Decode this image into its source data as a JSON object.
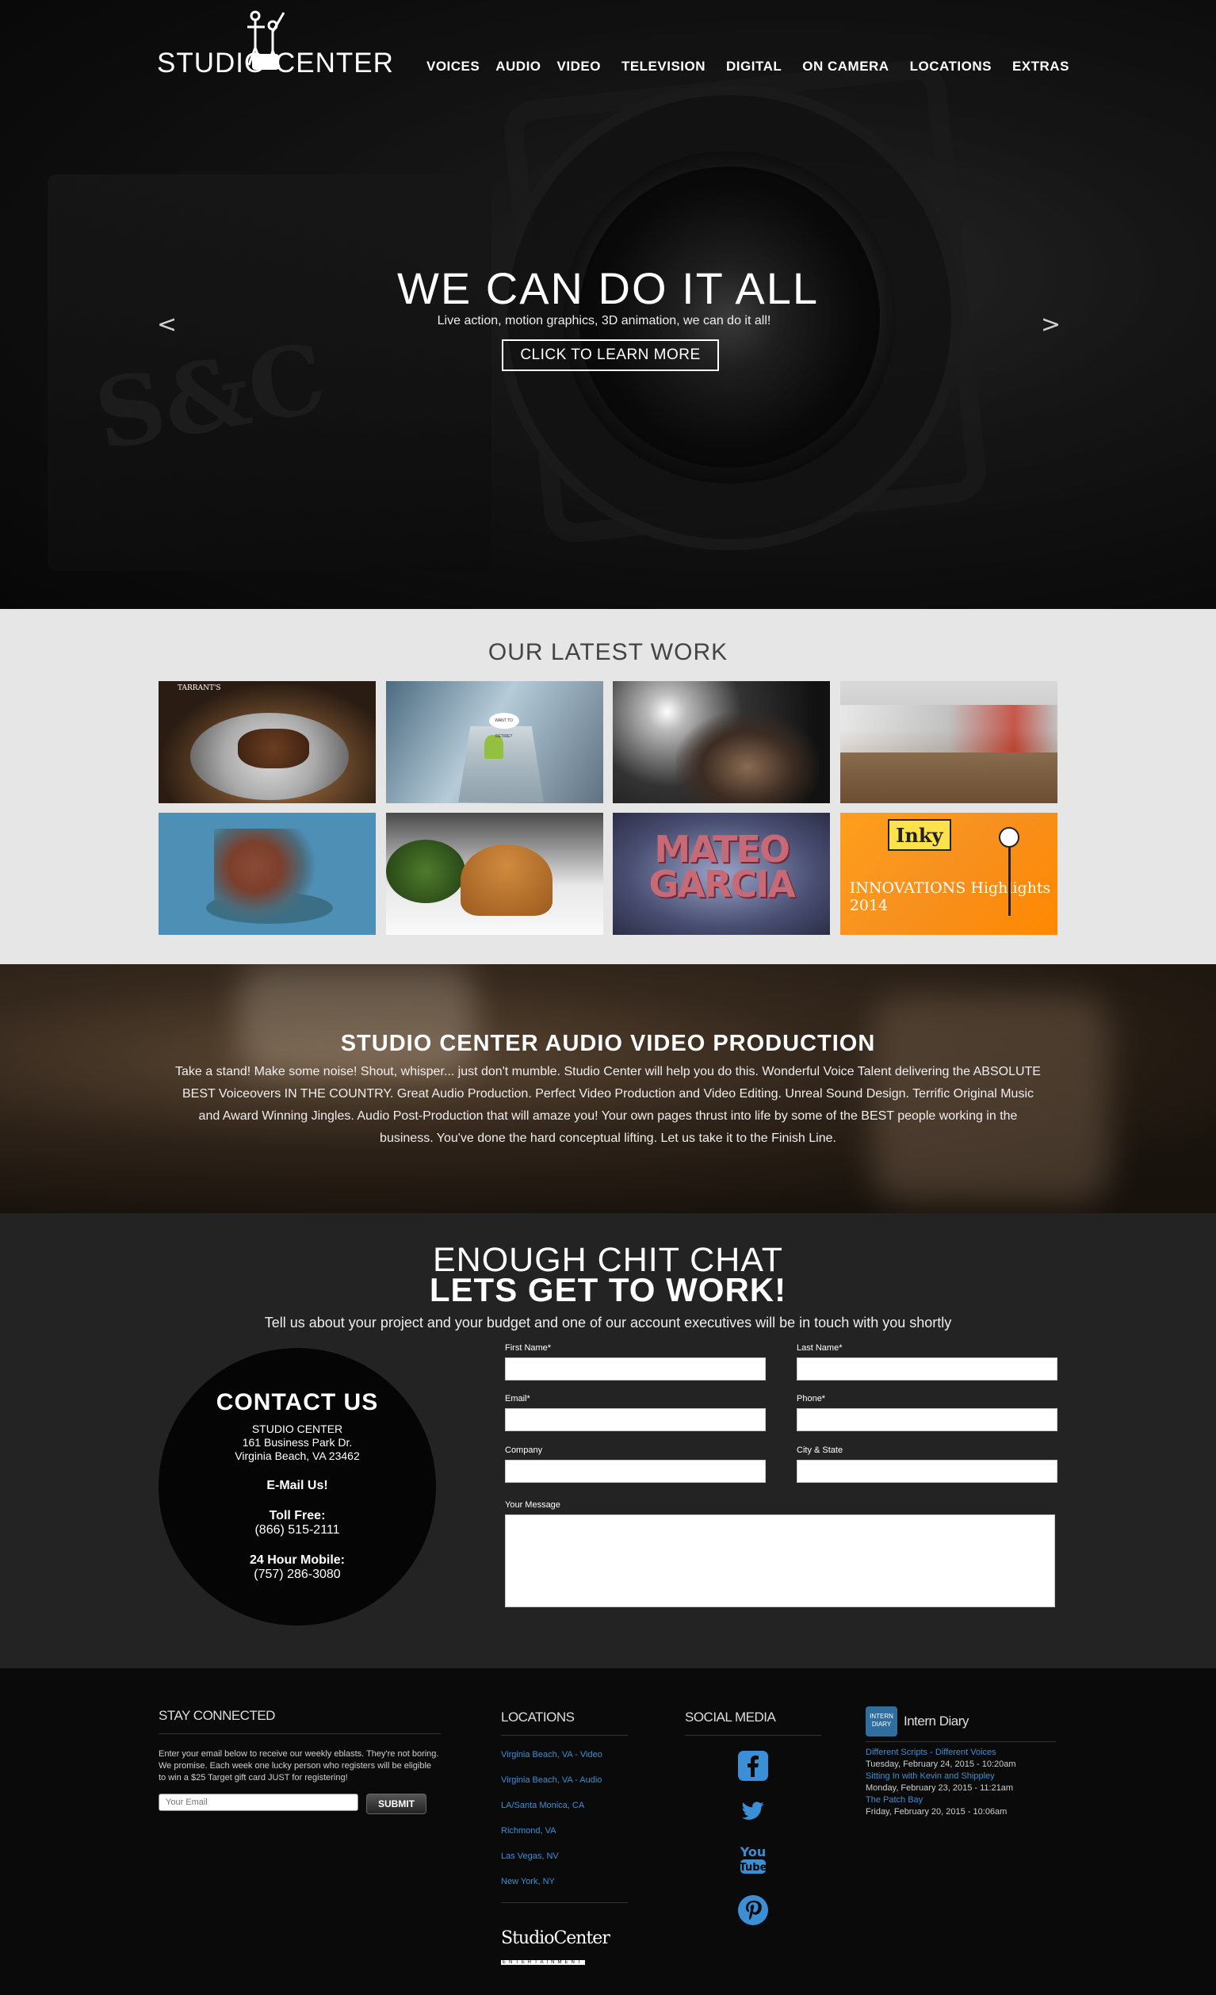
{
  "brand": {
    "name": "STUDIO CENTER"
  },
  "nav": [
    "VOICES",
    "AUDIO",
    "VIDEO",
    "TELEVISION",
    "DIGITAL",
    "ON CAMERA",
    "LOCATIONS",
    "EXTRAS"
  ],
  "hero": {
    "title": "WE CAN DO IT ALL",
    "subtitle": "Live action, motion graphics, 3D animation, we can do it all!",
    "cta": "CLICK TO LEARN MORE",
    "prev": "<",
    "next": ">"
  },
  "work": {
    "heading": "OUR LATEST WORK",
    "thumb_labels": {
      "t1": "TARRANT'S",
      "t2": "WANT TO RETIRE?",
      "t7": "MATEO GARCIA",
      "t8_inky": "Inky",
      "t8_sub": "INNOVATIONS Highlights 2014"
    }
  },
  "production": {
    "heading": "STUDIO CENTER AUDIO VIDEO PRODUCTION",
    "body": "Take a stand! Make some noise! Shout, whisper... just don't mumble. Studio Center will help you do this. Wonderful Voice Talent delivering the ABSOLUTE BEST Voiceovers IN THE COUNTRY. Great Audio Production. Perfect Video Production and Video Editing. Unreal Sound Design. Terrific Original Music and Award Winning Jingles. Audio Post-Production that will amaze you! Your own pages thrust into life by some of the BEST people working in the business. You've done the hard conceptual lifting. Let us take it to the Finish Line."
  },
  "contact": {
    "heading1": "ENOUGH CHIT CHAT",
    "heading2": "LETS GET TO WORK!",
    "intro": "Tell us about your project and your budget and one of our account executives will be in touch with you shortly",
    "circle": {
      "title": "CONTACT US",
      "company": "STUDIO CENTER",
      "address1": "161 Business Park Dr.",
      "address2": "Virginia Beach, VA 23462",
      "email": "E-Mail Us!",
      "tollfree_label": "Toll Free:",
      "tollfree": "(866) 515-2111",
      "mobile_label": "24 Hour Mobile:",
      "mobile": "(757) 286-3080"
    },
    "form": {
      "first_name": "First Name*",
      "last_name": "Last Name*",
      "email": "Email*",
      "phone": "Phone*",
      "company": "Company",
      "city_state": "City & State",
      "message": "Your Message"
    }
  },
  "footer": {
    "stay": {
      "heading": "STAY CONNECTED",
      "text": "Enter your email below to receive our weekly eblasts. They're not boring. We promise. Each week one lucky person who registers will be eligible to win a $25 Target gift card JUST for registering!",
      "placeholder": "Your Email",
      "submit": "SUBMIT"
    },
    "locations": {
      "heading": "LOCATIONS",
      "items": [
        "Virginia Beach, VA - Video",
        "Virginia Beach, VA - Audio",
        "LA/Santa Monica, CA",
        "Richmond, VA",
        "Las Vegas, NV",
        "New York, NY"
      ]
    },
    "brand": {
      "name": "StudioCenter",
      "tag": "ENTERTAINMENT"
    },
    "social": {
      "heading": "SOCIAL MEDIA",
      "icons": [
        "facebook-icon",
        "twitter-icon",
        "youtube-icon",
        "pinterest-icon"
      ],
      "color": "#3a8fd6"
    },
    "diary": {
      "heading": "Intern Diary",
      "icon_text": "INTERN DIARY",
      "entries": [
        {
          "title": "Different Scripts - Different Voices",
          "date": "Tuesday, February 24, 2015 - 10:20am"
        },
        {
          "title": "Sitting In with Kevin and Shippley",
          "date": "Monday, February 23, 2015 - 11:21am"
        },
        {
          "title": "The Patch Bay",
          "date": "Friday, February 20, 2015 - 10:06am"
        }
      ]
    }
  }
}
